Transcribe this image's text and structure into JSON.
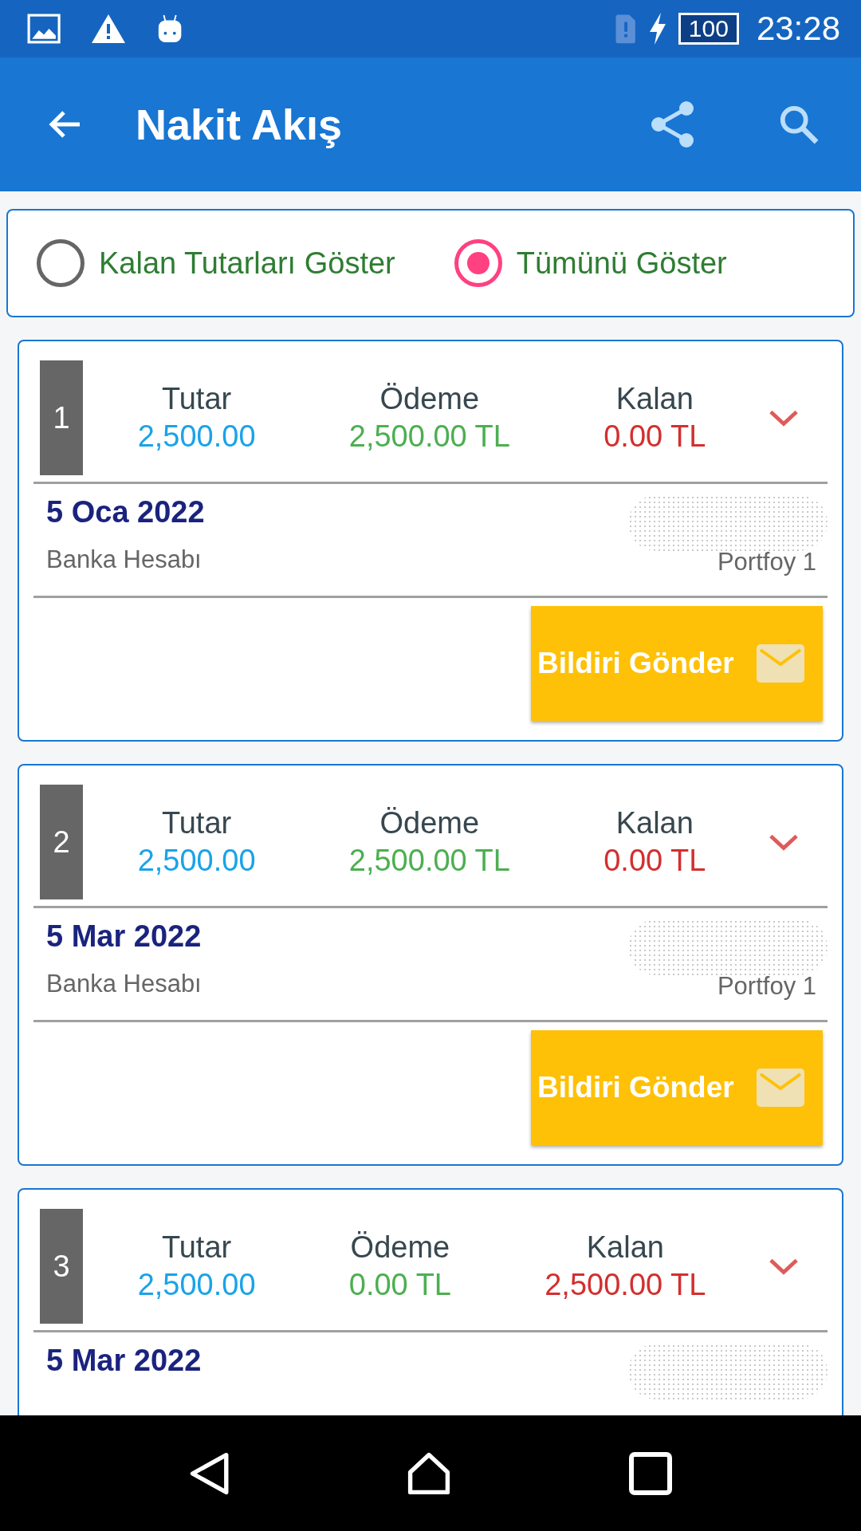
{
  "status_bar": {
    "battery": "100",
    "time": "23:28"
  },
  "app_bar": {
    "title": "Nakit Akış"
  },
  "filter": {
    "options": [
      {
        "label": "Kalan Tutarları Göster",
        "selected": false
      },
      {
        "label": "Tümünü Göster",
        "selected": true
      }
    ]
  },
  "entries": [
    {
      "number": "1",
      "amounts": [
        {
          "kind": "tutar",
          "label": "Tutar",
          "value": "2,500.00"
        },
        {
          "kind": "odeme",
          "label": "Ödeme",
          "value": "2,500.00 TL"
        },
        {
          "kind": "kalan",
          "label": "Kalan",
          "value": "0.00 TL"
        }
      ],
      "date": "5 Oca 2022",
      "account": "Banka Hesabı",
      "portfolio": "Portfoy 1",
      "button": "Bildiri Gönder"
    },
    {
      "number": "2",
      "amounts": [
        {
          "kind": "tutar",
          "label": "Tutar",
          "value": "2,500.00"
        },
        {
          "kind": "odeme",
          "label": "Ödeme",
          "value": "2,500.00 TL"
        },
        {
          "kind": "kalan",
          "label": "Kalan",
          "value": "0.00 TL"
        }
      ],
      "date": "5 Mar 2022",
      "account": "Banka Hesabı",
      "portfolio": "Portfoy 1",
      "button": "Bildiri Gönder"
    },
    {
      "number": "3",
      "amounts": [
        {
          "kind": "tutar",
          "label": "Tutar",
          "value": "2,500.00"
        },
        {
          "kind": "odeme",
          "label": "Ödeme",
          "value": "0.00 TL"
        },
        {
          "kind": "kalan",
          "label": "Kalan",
          "value": "2,500.00 TL"
        }
      ],
      "date": "5 Mar 2022"
    }
  ]
}
